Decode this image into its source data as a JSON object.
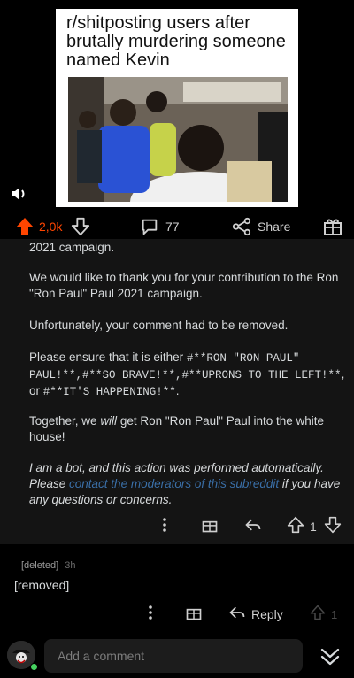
{
  "meme": {
    "caption": "r/shitposting users after brutally murdering someone named Kevin"
  },
  "post_actions": {
    "upvote_count": "2,0k",
    "comment_count": "77",
    "share_label": "Share"
  },
  "colors": {
    "upvote_accent": "#ff4500",
    "link": "#3a6fa8",
    "comment_bg": "#141414"
  },
  "bot_comment": {
    "cutoff_line": "2021 campaign.",
    "para1": "We would like to thank you for your contribution to the Ron \"Ron Paul\" Paul 2021 campaign.",
    "para2": "Unfortunately, your comment had to be removed.",
    "para3_prefix": "Please ensure that it is either ",
    "para3_codes": "#**RON \"RON PAUL\" PAUL!**,#**SO BRAVE!**,#**UPRONS TO THE LEFT!**",
    "para3_or": ", or ",
    "para3_last": "#**IT'S HAPPENING!**",
    "para3_end": ".",
    "para4_a": "Together, we ",
    "para4_em": "will",
    "para4_b": " get Ron \"Ron Paul\" Paul into the white house!",
    "para5_a": "I am a bot, and this action was performed automatically. Please ",
    "para5_link": "contact the moderators of this subreddit",
    "para5_b": " if you have any questions or concerns.",
    "vote_count": "1"
  },
  "deleted_comment": {
    "author": "[deleted]",
    "age": "3h",
    "body": "[removed]",
    "reply_label": "Reply",
    "vote_count": "1"
  },
  "composer": {
    "placeholder": "Add a comment"
  },
  "icons": [
    "speaker-icon",
    "upvote-icon",
    "downvote-icon",
    "comment-icon",
    "share-icon",
    "award-icon",
    "more-icon",
    "reply-icon",
    "collapse-icon"
  ]
}
